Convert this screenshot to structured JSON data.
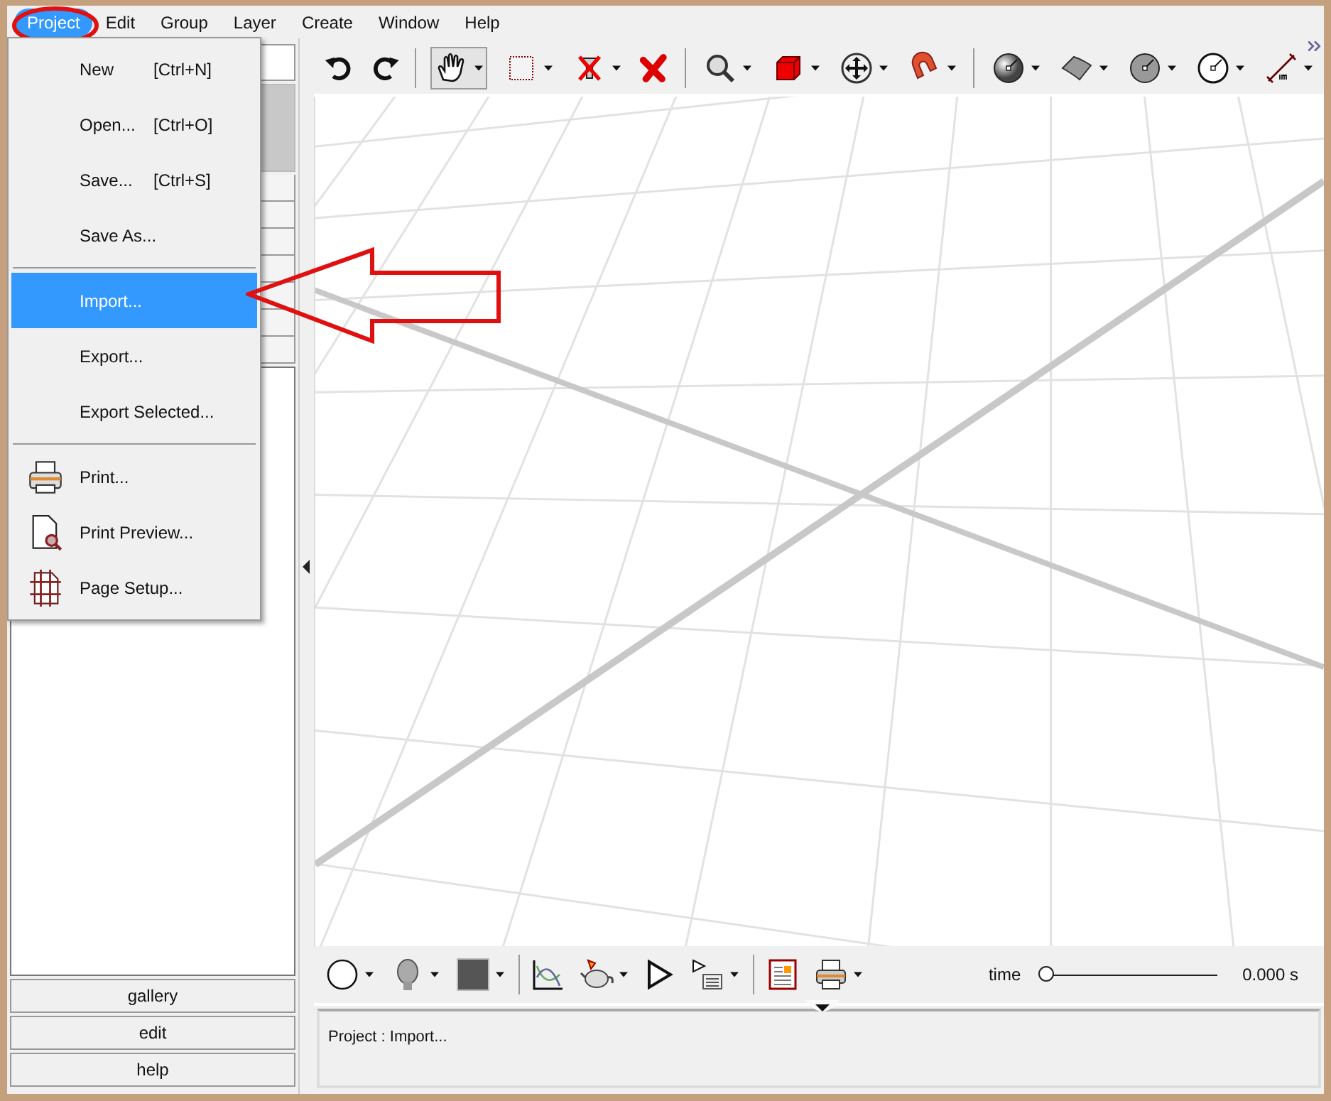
{
  "menubar": [
    {
      "label": "Project",
      "selected": true
    },
    {
      "label": "Edit",
      "selected": false
    },
    {
      "label": "Group",
      "selected": false
    },
    {
      "label": "Layer",
      "selected": false
    },
    {
      "label": "Create",
      "selected": false
    },
    {
      "label": "Window",
      "selected": false
    },
    {
      "label": "Help",
      "selected": false
    }
  ],
  "project_menu": [
    {
      "kind": "item",
      "label": "New",
      "shortcut": "[Ctrl+N]",
      "selected": false
    },
    {
      "kind": "item",
      "label": "Open...",
      "shortcut": "[Ctrl+O]",
      "selected": false
    },
    {
      "kind": "item",
      "label": "Save...",
      "shortcut": "[Ctrl+S]",
      "selected": false
    },
    {
      "kind": "item",
      "label": "Save As...",
      "selected": false
    },
    {
      "kind": "separator"
    },
    {
      "kind": "item",
      "label": "Import...",
      "selected": true
    },
    {
      "kind": "item",
      "label": "Export...",
      "selected": false
    },
    {
      "kind": "item",
      "label": "Export Selected...",
      "selected": false
    },
    {
      "kind": "separator"
    },
    {
      "kind": "iconitem",
      "label": "Print...",
      "selected": false
    },
    {
      "kind": "iconitem",
      "label": "Print Preview...",
      "selected": false
    },
    {
      "kind": "iconitem",
      "label": "Page Setup...",
      "selected": false
    }
  ],
  "side_panel": {
    "buttons": [
      "gallery",
      "edit",
      "help"
    ]
  },
  "time_slider": {
    "label": "time",
    "level": 0,
    "reading": "0.000 s"
  },
  "status": "Project : Import..."
}
